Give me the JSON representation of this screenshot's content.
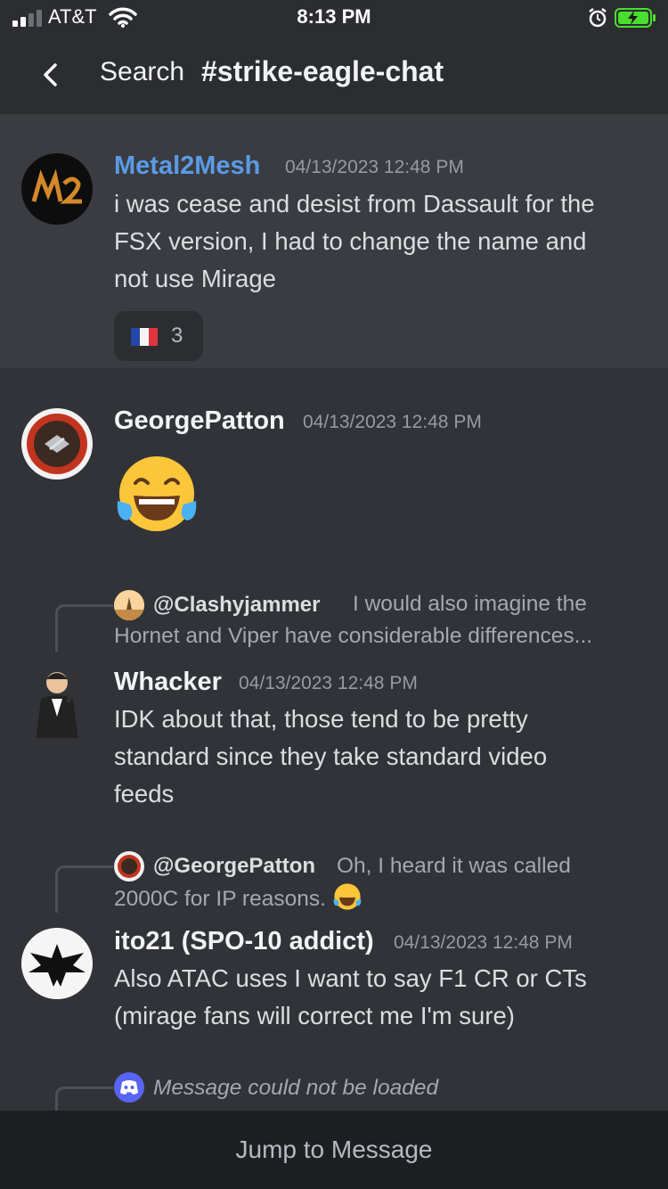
{
  "status_bar": {
    "carrier": "AT&T",
    "time": "8:13 PM",
    "battery_color": "#4ade2f"
  },
  "header": {
    "back_icon": "chevron-left-icon",
    "search_label": "Search",
    "channel_name": "#strike-eagle-chat"
  },
  "messages": [
    {
      "author": "Metal2Mesh",
      "author_color": "#5b9be6",
      "timestamp": "04/13/2023 12:48 PM",
      "lines": [
        "i was cease and desist from Dassault for the",
        "FSX version, I had to change the name and",
        "not use Mirage"
      ],
      "reaction": {
        "emoji": "french-flag-icon",
        "count": "3"
      },
      "highlighted": true
    },
    {
      "author": "GeorgePatton",
      "timestamp": "04/13/2023 12:48 PM",
      "emoji_only": "tears-of-joy-emoji"
    },
    {
      "reply_to": {
        "name": "@Clashyjammer",
        "lines": [
          "I would also imagine the",
          "Hornet and Viper have considerable differences..."
        ]
      },
      "author": "Whacker",
      "timestamp": "04/13/2023 12:48 PM",
      "lines": [
        "IDK about that, those tend to be pretty",
        "standard since they take standard video",
        "feeds"
      ]
    },
    {
      "reply_to": {
        "name": "@GeorgePatton",
        "lines": [
          "Oh, I heard it was called",
          "2000C for IP reasons."
        ]
      },
      "author": "ito21 (SPO-10 addict)",
      "timestamp": "04/13/2023 12:48 PM",
      "lines": [
        "Also ATAC uses I want to say F1 CR or CTs",
        "(mirage fans will correct me I'm sure)"
      ]
    },
    {
      "reply_to": {
        "text": "Message could not be loaded"
      }
    }
  ],
  "footer": {
    "jump_label": "Jump to Message"
  }
}
